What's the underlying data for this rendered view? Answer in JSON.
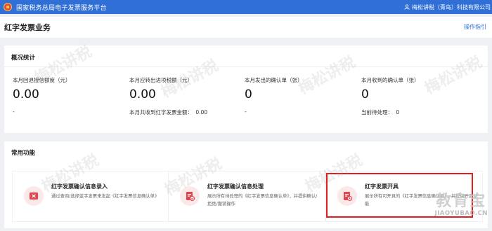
{
  "header": {
    "title": "国家税务总局电子发票服务平台",
    "user_name": "梅松讲税（青岛）科技有限公司"
  },
  "page": {
    "title": "红字发票业务",
    "guide_link": "操作指引"
  },
  "overview": {
    "title": "概况统计",
    "stats": [
      {
        "label": "本月回退授信额度（元）",
        "value": "0.00",
        "sub": "-"
      },
      {
        "label": "本月应转出进项税额（元）",
        "value": "0.00",
        "sub_label": "本月共收到红字发票金额：",
        "sub_value": "0.00"
      },
      {
        "label": "本月发出的确认单（张）",
        "value": "0",
        "sub": "-"
      },
      {
        "label": "本月收到的确认单（张）",
        "value": "0",
        "sub_label": "当前待处理：",
        "sub_value": "0"
      }
    ]
  },
  "functions": {
    "title": "常用功能",
    "items": [
      {
        "name": "红字发票确认信息录入",
        "desc": "通过查询/选择蓝字发票来发起《红字发票信息确认单》"
      },
      {
        "name": "红字发票确认信息处理",
        "desc": "展示所有待处理的《红字发票信息确认单》，并提供确认/拒绝/撤销操作"
      },
      {
        "name": "红字发票开具",
        "desc": "展示所有可开具的《红字发票信息确认单》，并提供开具功能"
      }
    ]
  },
  "watermark_text": "梅松讲税",
  "brand": {
    "line1": "教育宝",
    "line2": "JIAOYUBAO.CN"
  },
  "colors": {
    "primary": "#2f6fd6",
    "icon_red": "#e0474c",
    "highlight": "#e01e1e"
  }
}
